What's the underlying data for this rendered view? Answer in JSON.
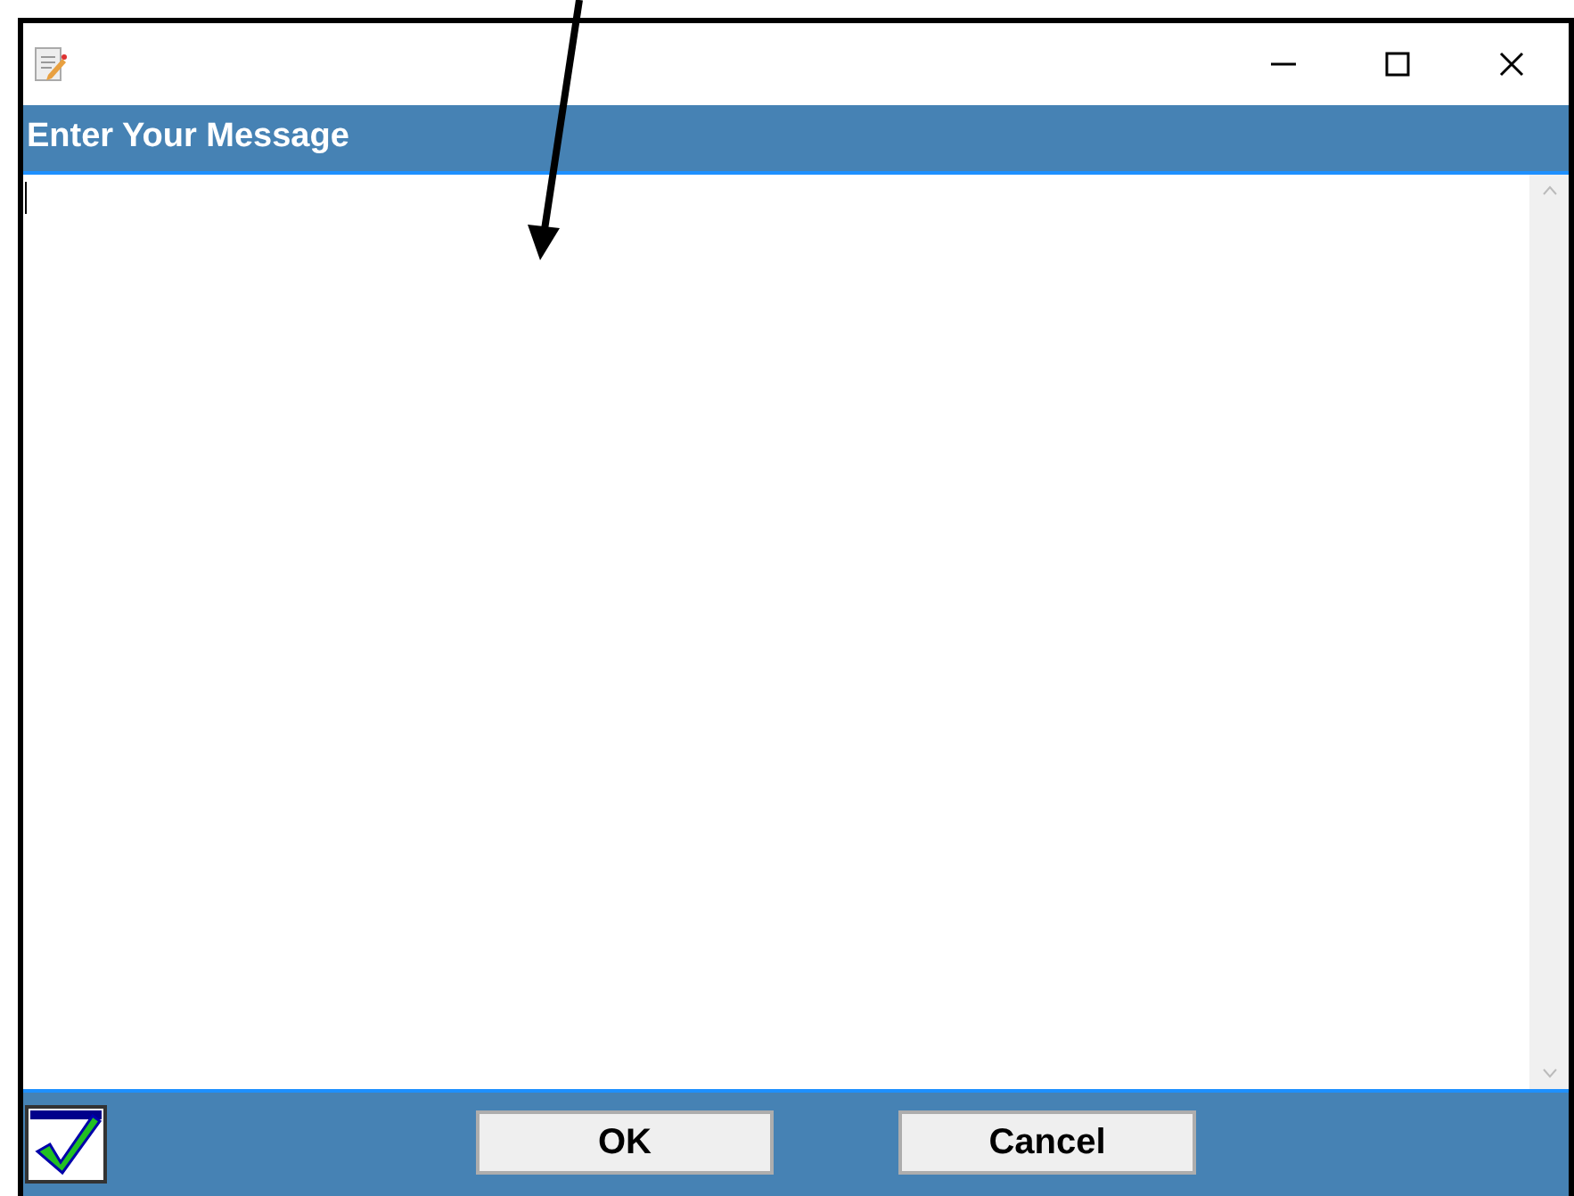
{
  "header": {
    "title": "Enter Your Message"
  },
  "buttons": [
    {
      "label": "OK"
    },
    {
      "label": "Cancel"
    }
  ]
}
